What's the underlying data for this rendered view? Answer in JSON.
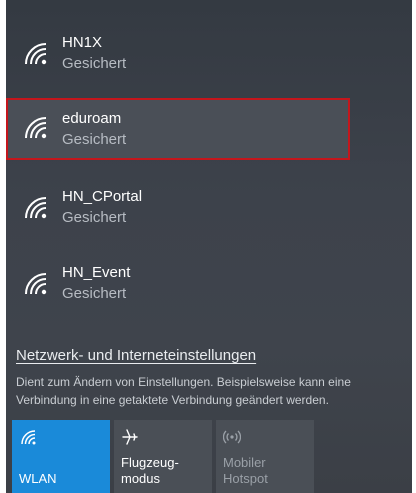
{
  "networks": [
    {
      "name": "HN1X",
      "status": "Gesichert"
    },
    {
      "name": "eduroam",
      "status": "Gesichert"
    },
    {
      "name": "HN_CPortal",
      "status": "Gesichert"
    },
    {
      "name": "HN_Event",
      "status": "Gesichert"
    }
  ],
  "selected_network": "eduroam",
  "settings": {
    "link": "Netzwerk- und Interneteinstellungen",
    "description": "Dient zum Ändern von Einstellungen. Beispielsweise kann eine Verbindung in eine getaktete Verbindung geändert werden."
  },
  "quick_actions": {
    "wlan": "WLAN",
    "airplane": "Flugzeug-\nmodus",
    "hotspot": "Mobiler\nHotspot"
  },
  "colors": {
    "accent": "#1a8ad9",
    "highlight_border": "#c4161c"
  },
  "icons": [
    "wifi-icon",
    "airplane-icon",
    "hotspot-icon"
  ]
}
